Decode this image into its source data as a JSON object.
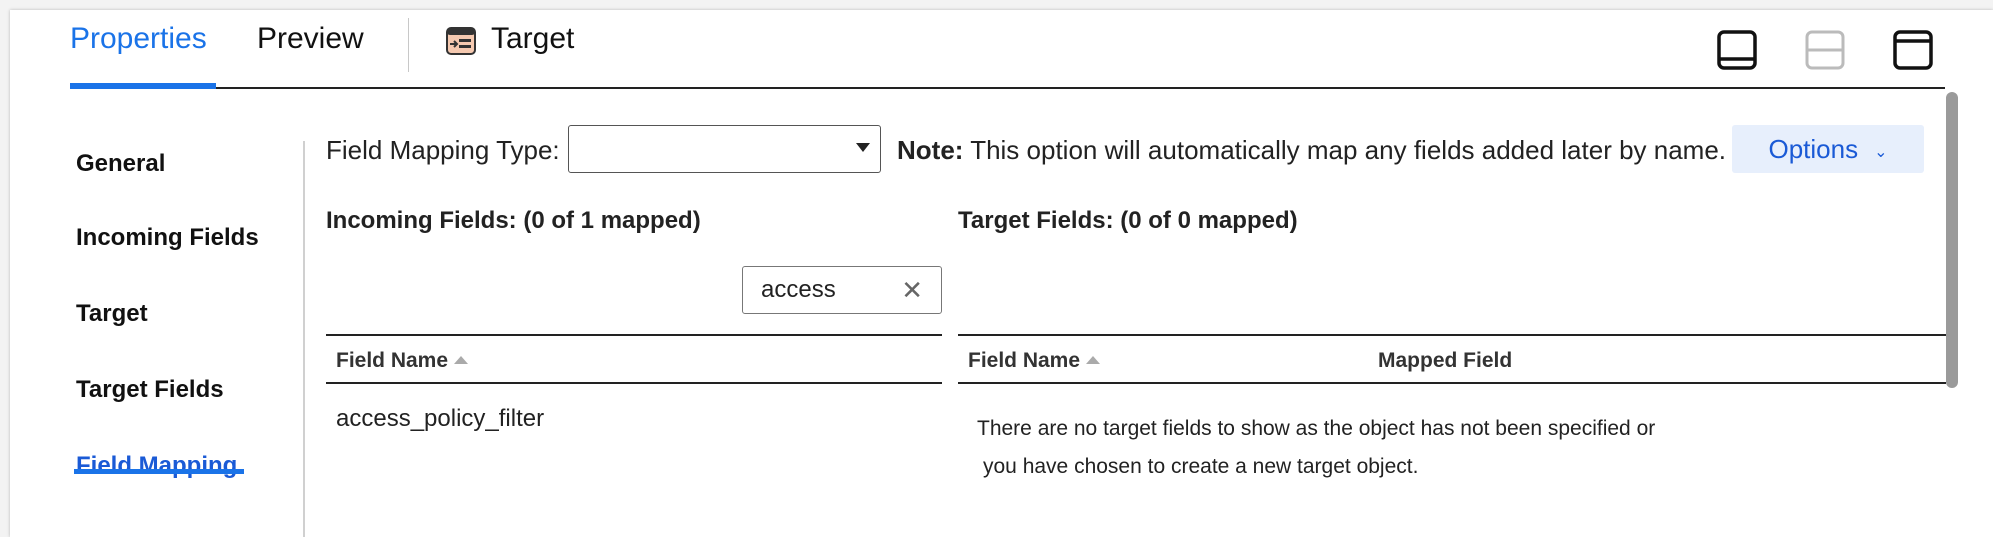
{
  "tabs": {
    "properties": "Properties",
    "preview": "Preview",
    "target": "Target"
  },
  "nav": {
    "items": [
      "General",
      "Incoming Fields",
      "Target",
      "Target Fields",
      "Field Mapping"
    ],
    "active": "Field Mapping"
  },
  "mapping": {
    "type_label": "Field Mapping Type:",
    "type_value": "",
    "note_bold": "Note:",
    "note_text": " This option will automatically map any fields added later by name.",
    "options_label": "Options"
  },
  "incoming": {
    "title": "Incoming Fields: (0 of 1 mapped)",
    "search_value": "access",
    "columns": [
      "Field Name"
    ],
    "rows": [
      "access_policy_filter"
    ]
  },
  "target": {
    "title": "Target Fields: (0 of 0 mapped)",
    "columns": [
      "Field Name",
      "Mapped Field"
    ],
    "empty_line1": "There are no target fields to show as the object has not been specified or",
    "empty_line2": "you have chosen to create a new target object."
  },
  "colors": {
    "accent": "#1a73e8",
    "link": "#1a5ad6",
    "options_bg": "#e7effc"
  },
  "icons": [
    "target-object-icon",
    "layout-bottom-panel-icon",
    "layout-split-icon",
    "layout-top-panel-icon",
    "dropdown-caret-icon",
    "chevron-down-icon",
    "clear-icon",
    "sort-ascending-icon"
  ]
}
